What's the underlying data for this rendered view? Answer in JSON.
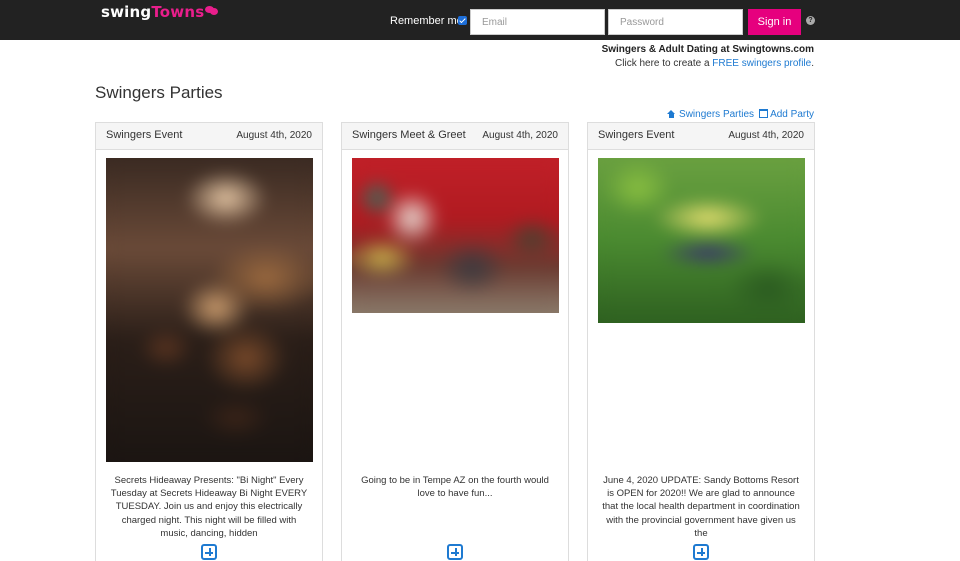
{
  "header": {
    "logo_part1": "swing",
    "logo_part2": "Towns",
    "remember_label": "Remember me",
    "remember_checked": true,
    "email_placeholder": "Email",
    "password_placeholder": "Password",
    "signin_label": "Sign in",
    "help_icon": "?"
  },
  "promo": {
    "headline": "Swingers & Adult Dating at Swingtowns.com",
    "line_prefix": "Click here to create a ",
    "line_link": "FREE swingers profile",
    "line_suffix": "."
  },
  "page_title": "Swingers Parties",
  "links": {
    "parties": "Swingers Parties",
    "add_party": "Add Party"
  },
  "cards": [
    {
      "title": "Swingers Event",
      "date": "August 4th, 2020",
      "description": "Secrets Hideaway Presents: \"Bi Night\" Every Tuesday at Secrets Hideaway Bi Night EVERY TUESDAY. Join us and enjoy this electrically charged night. This night will be filled with music, dancing, hidden"
    },
    {
      "title": "Swingers Meet & Greet",
      "date": "August 4th, 2020",
      "description": "Going to be in Tempe AZ on the fourth would love to have fun..."
    },
    {
      "title": "Swingers Event",
      "date": "August 4th, 2020",
      "description": "June 4, 2020 UPDATE: Sandy Bottoms Resort is OPEN for 2020!! We are glad to announce that the local health department in coordination with the provincial government have given us the"
    }
  ]
}
